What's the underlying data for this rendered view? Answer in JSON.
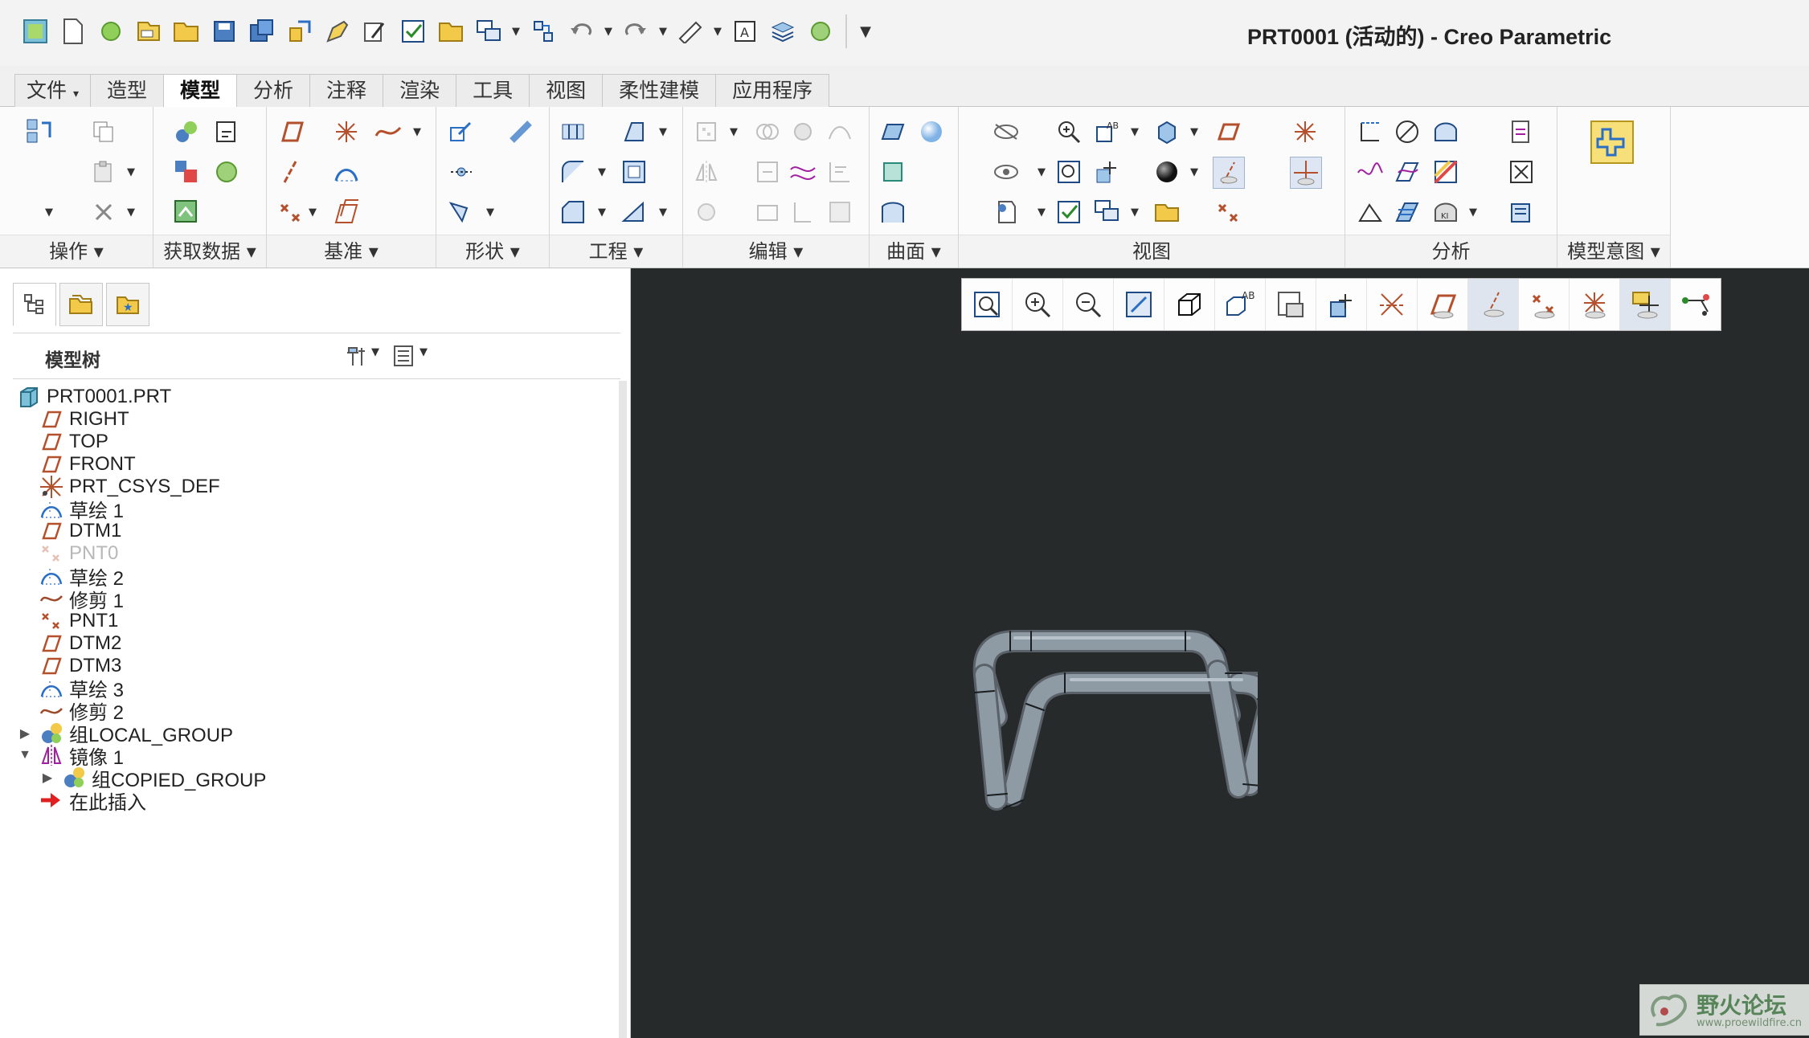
{
  "window": {
    "title": "PRT0001 (活动的) - Creo Parametric"
  },
  "tabs": [
    {
      "label": "文件",
      "active": false
    },
    {
      "label": "造型",
      "active": false
    },
    {
      "label": "模型",
      "active": true
    },
    {
      "label": "分析",
      "active": false
    },
    {
      "label": "注释",
      "active": false
    },
    {
      "label": "渲染",
      "active": false
    },
    {
      "label": "工具",
      "active": false
    },
    {
      "label": "视图",
      "active": false
    },
    {
      "label": "柔性建模",
      "active": false
    },
    {
      "label": "应用程序",
      "active": false
    }
  ],
  "ribbon_groups": [
    {
      "label": "操作 ▾"
    },
    {
      "label": "获取数据 ▾"
    },
    {
      "label": "基准 ▾"
    },
    {
      "label": "形状 ▾"
    },
    {
      "label": "工程 ▾"
    },
    {
      "label": "编辑 ▾"
    },
    {
      "label": "曲面 ▾"
    },
    {
      "label": "视图"
    },
    {
      "label": "分析"
    },
    {
      "label": "模型意图 ▾"
    }
  ],
  "model_tree": {
    "title": "模型树",
    "items": [
      {
        "label": "PRT0001.PRT",
        "icon": "part-icon"
      },
      {
        "label": "RIGHT",
        "icon": "datum-plane-icon"
      },
      {
        "label": "TOP",
        "icon": "datum-plane-icon"
      },
      {
        "label": "FRONT",
        "icon": "datum-plane-icon"
      },
      {
        "label": "PRT_CSYS_DEF",
        "icon": "csys-icon"
      },
      {
        "label": "草绘 1",
        "icon": "sketch-icon"
      },
      {
        "label": "DTM1",
        "icon": "datum-plane-icon"
      },
      {
        "label": "PNT0",
        "icon": "datum-point-icon",
        "state": "suppressed"
      },
      {
        "label": "草绘 2",
        "icon": "sketch-icon"
      },
      {
        "label": "修剪 1",
        "icon": "trim-curve-icon"
      },
      {
        "label": "PNT1",
        "icon": "datum-point-icon"
      },
      {
        "label": "DTM2",
        "icon": "datum-plane-icon"
      },
      {
        "label": "DTM3",
        "icon": "datum-plane-icon"
      },
      {
        "label": "草绘 3",
        "icon": "sketch-icon"
      },
      {
        "label": "修剪 2",
        "icon": "trim-curve-icon"
      },
      {
        "label": "组LOCAL_GROUP",
        "icon": "group-icon",
        "expand": "collapsed"
      },
      {
        "label": "镜像 1",
        "icon": "mirror-icon",
        "expand": "expanded"
      },
      {
        "label": "组COPIED_GROUP",
        "icon": "group-icon",
        "expand": "collapsed"
      },
      {
        "label": "在此插入",
        "icon": "insert-here-arrow-icon"
      }
    ]
  },
  "colors": {
    "viewport_bg": "#272a2b",
    "tube": "#8e9aa4",
    "plane_icon": "#b5502c",
    "sketch_icon": "#2a6fc4",
    "insert_arrow": "#e02020"
  },
  "watermark": {
    "cn": "野火论坛",
    "url": "www.proewildfire.cn"
  }
}
